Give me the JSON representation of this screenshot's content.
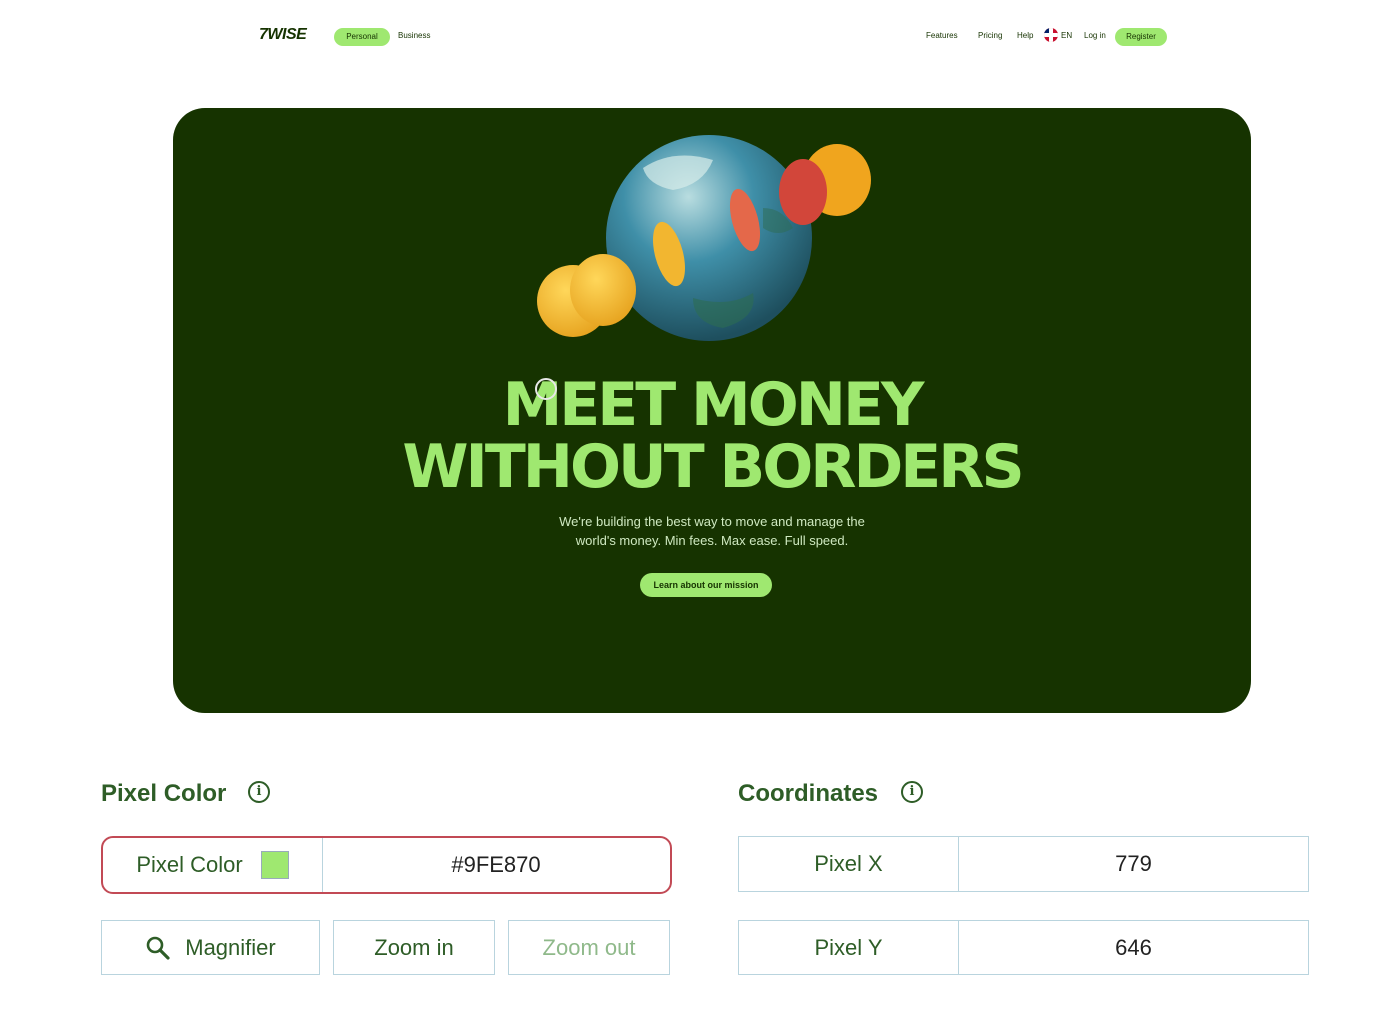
{
  "site": {
    "logo": "7WISE",
    "nav_left": [
      "Personal",
      "Business"
    ],
    "nav_right": [
      "Features",
      "Pricing",
      "Help",
      "EN",
      "Log in",
      "Register"
    ]
  },
  "hero": {
    "headline_line1": "MEET MONEY",
    "headline_line2": "WITHOUT BORDERS",
    "subtitle_line1": "We're building the best way to move and manage the",
    "subtitle_line2": "world's money. Min fees. Max ease. Full speed.",
    "cta": "Learn about our mission"
  },
  "pixel_color": {
    "title": "Pixel Color",
    "label": "Pixel Color",
    "hex": "#9FE870",
    "swatch_color": "#9FE870"
  },
  "coordinates": {
    "title": "Coordinates",
    "x_label": "Pixel X",
    "x_value": "779",
    "y_label": "Pixel Y",
    "y_value": "646"
  },
  "tools": {
    "magnifier": "Magnifier",
    "zoom_in": "Zoom in",
    "zoom_out": "Zoom out"
  },
  "colors": {
    "brand_green": "#9FE870",
    "forest": "#163300",
    "highlight_border": "#c24a55"
  }
}
